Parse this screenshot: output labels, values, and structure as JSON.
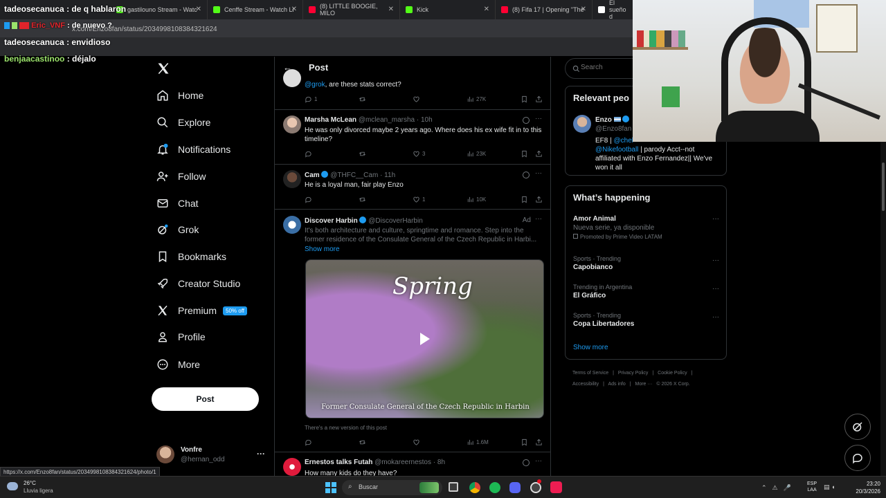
{
  "browser": {
    "tabs": [
      {
        "label": "gastilouno Stream - Watc",
        "color": "#53fc18"
      },
      {
        "label": "Cenffe Stream - Watch Li",
        "color": "#53fc18"
      },
      {
        "label": "(8) LITTLE BOOGIE, MILO",
        "color": "#ff0033"
      },
      {
        "label": "Kick",
        "color": "#53fc18"
      },
      {
        "label": "(8) Fifa 17 | Opening \"The",
        "color": "#ff0033"
      },
      {
        "label": "El sueño d",
        "color": "#ffffff"
      }
    ],
    "address": "x.com/Enzo8fan/status/2034998108384321624",
    "status_url": "https://x.com/Enzo8fan/status/2034998108384321624/photo/1"
  },
  "chat_overlay": [
    {
      "user": "tadeosecanuca",
      "msg": ": de q hablaron",
      "color": "#ffffff"
    },
    {
      "user": "Eric_VNF",
      "msg": ": de nuevo ?",
      "color": "#e0242b"
    },
    {
      "user": "tadeosecanuca",
      "msg": ": envidioso",
      "color": "#ffffff"
    },
    {
      "user": "benjaacastinoo",
      "msg": ": déjalo",
      "color": "#9be36b"
    }
  ],
  "nav": {
    "items": [
      {
        "label": "Home",
        "icon": "home-icon"
      },
      {
        "label": "Explore",
        "icon": "search-icon"
      },
      {
        "label": "Notifications",
        "icon": "bell-icon"
      },
      {
        "label": "Follow",
        "icon": "add-person-icon"
      },
      {
        "label": "Chat",
        "icon": "mail-icon"
      },
      {
        "label": "Grok",
        "icon": "grok-icon"
      },
      {
        "label": "Bookmarks",
        "icon": "bookmark-icon"
      },
      {
        "label": "Creator Studio",
        "icon": "rocket-icon"
      },
      {
        "label": "Premium",
        "icon": "x-logo-icon"
      },
      {
        "label": "Profile",
        "icon": "person-icon"
      },
      {
        "label": "More",
        "icon": "more-circle-icon"
      }
    ],
    "premium_badge": "50% off",
    "notifications_badge": "1",
    "post_button": "Post",
    "account": {
      "name": "Vonfre",
      "handle": "@hernan_odd",
      "more": "···"
    }
  },
  "main": {
    "title": "Post",
    "posts": [
      {
        "text_link": "@grok",
        "text": ", are these stats correct?",
        "replies": "1",
        "retweets": "",
        "likes": "",
        "views": "27K"
      },
      {
        "name": "Marsha McLean",
        "handle": "@mclean_marsha · 10h",
        "text": "He was only divorced maybe 2 years ago. Where does his ex wife fit in to this timeline?",
        "replies": "",
        "retweets": "",
        "likes": "3",
        "views": "23K"
      },
      {
        "name": "Cam",
        "handle": "@THFC__Cam · 11h",
        "text": "He is a loyal man, fair play Enzo",
        "replies": "",
        "retweets": "",
        "likes": "1",
        "views": "10K"
      },
      {
        "name": "Discover Harbin",
        "handle": "@DiscoverHarbin",
        "ad": "Ad",
        "text": "It's both architecture and culture, springtime and romance. Step into the former residence of the Consulate General of the Czech Republic in Harbi...",
        "show_more": "Show more",
        "media_title": "Spring",
        "media_caption": "Former Consulate General of the Czech Republic in Harbin",
        "new_version": "There's a new version of this post",
        "replies": "",
        "retweets": "",
        "likes": "",
        "views": "1.6M"
      },
      {
        "name": "Ernestos talks Futah",
        "handle": "@mokareernestos · 8h",
        "text": "How many kids do they have?"
      }
    ]
  },
  "right": {
    "search_placeholder": "Search",
    "relevant": {
      "title": "Relevant peo",
      "name": "Enzo",
      "handle": "@Enzo8fan",
      "bio_1": "EF8 | ",
      "bio_link_1": "@chel",
      "bio_link_2": "@Nikefootball",
      "bio_2": " | parody Acct--not affiliated with Enzo Fernandez|| We've won it all"
    },
    "happening": {
      "title": "What’s happening",
      "trends": [
        {
          "category": "",
          "title": "Amor Animal",
          "sub": "Nueva serie, ya disponible",
          "promo": "Promoted by Prime Video LATAM"
        },
        {
          "category": "Sports · Trending",
          "title": "Capobianco"
        },
        {
          "category": "Trending in Argentina",
          "title": "El Gráfico"
        },
        {
          "category": "Sports · Trending",
          "title": "Copa Libertadores"
        }
      ],
      "show_more": "Show more"
    },
    "footer": [
      "Terms of Service",
      "Privacy Policy",
      "Cookie Policy",
      "Accessibility",
      "Ads info",
      "More ···",
      "© 2026 X Corp."
    ]
  },
  "taskbar": {
    "weather_temp": "26°C",
    "weather_desc": "Lluvia ligera",
    "search": "Buscar",
    "lang_1": "ESP",
    "lang_2": "LAA",
    "time": "23:20",
    "date": "20/3/2026"
  },
  "colors": {
    "accent": "#1d9bf0",
    "text": "#e7e9ea",
    "muted": "#71767b",
    "border": "#2f3336"
  }
}
